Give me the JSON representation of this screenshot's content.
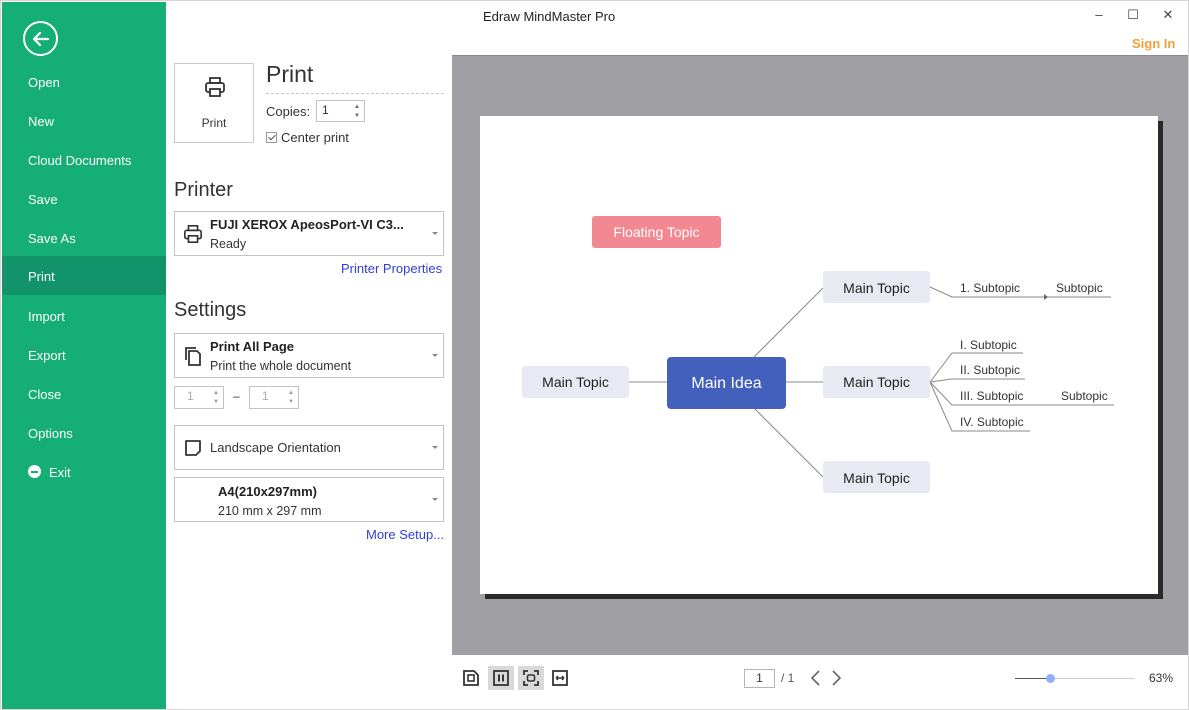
{
  "window": {
    "title": "Edraw MindMaster Pro",
    "controls": {
      "minimize": "–",
      "maximize": "☐",
      "close": "✕"
    },
    "sign_in": "Sign In"
  },
  "sidebar": {
    "back_icon": "arrow-left-circle-icon",
    "items": [
      {
        "label": "Open"
      },
      {
        "label": "New"
      },
      {
        "label": "Cloud Documents"
      },
      {
        "label": "Save"
      },
      {
        "label": "Save As"
      },
      {
        "label": "Print",
        "active": true
      },
      {
        "label": "Import"
      },
      {
        "label": "Export"
      },
      {
        "label": "Close"
      },
      {
        "label": "Options"
      },
      {
        "label": "Exit",
        "icon": "minus-circle-icon"
      }
    ]
  },
  "print": {
    "button_label": "Print",
    "title": "Print",
    "copies_label": "Copies:",
    "copies_value": "1",
    "center_print_label": "Center print",
    "center_print_checked": true
  },
  "printer": {
    "section_title": "Printer",
    "name": "FUJI XEROX ApeosPort-VI C3...",
    "status": "Ready",
    "properties_link": "Printer Properties"
  },
  "settings": {
    "section_title": "Settings",
    "range": {
      "title": "Print All Page",
      "subtitle": "Print the whole document"
    },
    "page_from": "1",
    "page_to": "1",
    "range_separator": "–",
    "orientation": "Landscape Orientation",
    "paper": {
      "title": "A4(210x297mm)",
      "subtitle": "210 mm x 297 mm"
    },
    "more_setup_link": "More Setup..."
  },
  "mindmap": {
    "floating_topic": "Floating Topic",
    "main_idea": "Main Idea",
    "left_topic": "Main Topic",
    "top_topic": {
      "label": "Main Topic",
      "subtopic": "1. Subtopic",
      "sub_subtopic": "Subtopic"
    },
    "middle_topic": {
      "label": "Main Topic",
      "subtopics": [
        "I. Subtopic",
        "II. Subtopic",
        "III. Subtopic",
        "IV. Subtopic"
      ],
      "sub_subtopic": "Subtopic"
    },
    "bottom_topic": "Main Topic",
    "colors": {
      "main_idea": "#4360bd",
      "floating": "#f28891",
      "topic_bg": "#e8e9f2",
      "line": "#8a8a8a"
    }
  },
  "bottom_bar": {
    "view_buttons": [
      "actual-size-icon",
      "two-page-icon",
      "fit-page-icon",
      "fit-width-icon"
    ],
    "selected_views": [
      1,
      2
    ],
    "current_page": "1",
    "total_pages": "/ 1",
    "zoom_percent": 63,
    "zoom_label": "63%",
    "zoom_slider_fraction": 0.29
  },
  "colors": {
    "sidebar": "#16ae77",
    "sidebar_active": "#12936a",
    "sign_in": "#f0a03c",
    "link": "#2f3fd6",
    "preview_bg": "#a09fa4"
  }
}
